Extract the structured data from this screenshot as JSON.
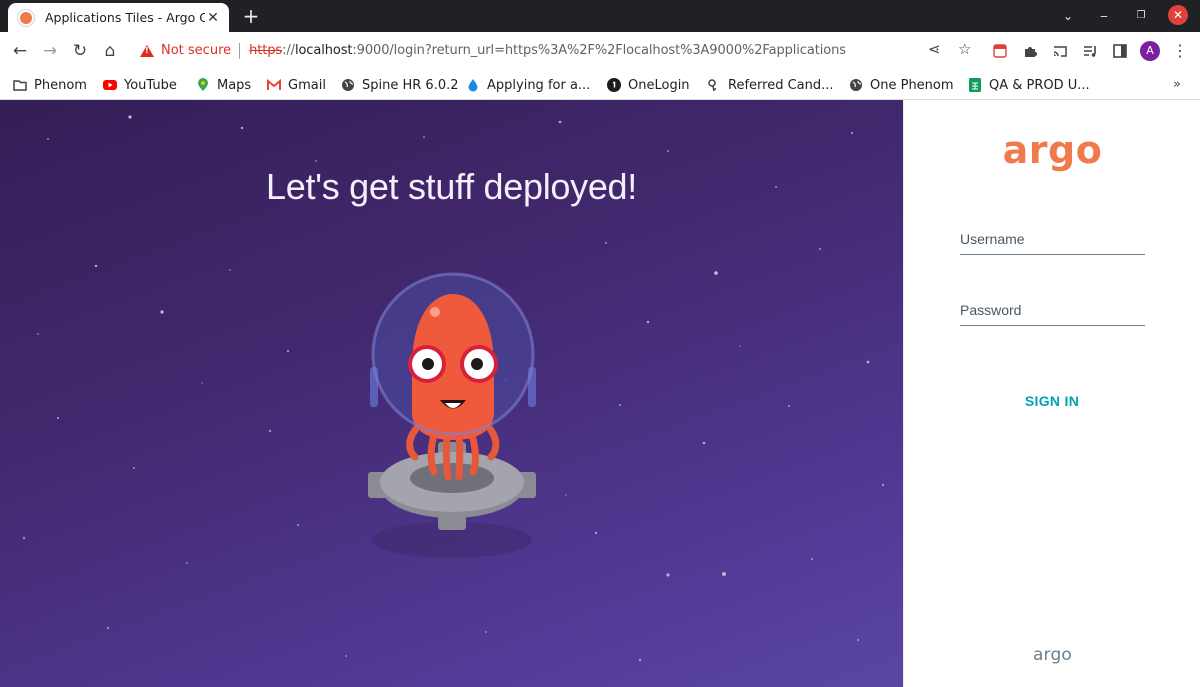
{
  "browser": {
    "tab_title": "Applications Tiles - Argo C",
    "new_tab_symbol": "+",
    "close_symbol": "✕",
    "security_label": "Not secure",
    "url": {
      "scheme": "https",
      "sep": "://",
      "host": "localhost",
      "rest": ":9000/login?return_url=https%3A%2F%2Flocalhost%3A9000%2Fapplications"
    },
    "avatar_letter": "A"
  },
  "bookmarks": [
    {
      "label": "Phenom",
      "icon": "folder-icon",
      "color": "#444444"
    },
    {
      "label": "YouTube",
      "icon": "youtube-icon",
      "color": "#ff0000"
    },
    {
      "label": "Maps",
      "icon": "maps-icon",
      "color": "#34a853"
    },
    {
      "label": "Gmail",
      "icon": "gmail-icon",
      "color": "#ea4335"
    },
    {
      "label": "Spine HR 6.0.2",
      "icon": "globe-icon",
      "color": "#444444"
    },
    {
      "label": "Applying for a...",
      "icon": "drop-icon",
      "color": "#1e88e5"
    },
    {
      "label": "OneLogin",
      "icon": "onelogin-icon",
      "color": "#1c1c1c"
    },
    {
      "label": "Referred Cand...",
      "icon": "key-icon",
      "color": "#444444"
    },
    {
      "label": "One Phenom",
      "icon": "globe-icon",
      "color": "#444444"
    },
    {
      "label": "QA & PROD U...",
      "icon": "sheets-icon",
      "color": "#0f9d58"
    }
  ],
  "bookmarks_more": "»",
  "hero": {
    "title": "Let's get stuff deployed!"
  },
  "login": {
    "logo": "argo",
    "username_label": "Username",
    "password_label": "Password",
    "signin_label": "SIGN IN",
    "footer_logo": "argo"
  },
  "colors": {
    "argo_orange": "#ef7b4d",
    "signin_teal": "#00a2b3",
    "hero_purple": "#42296f"
  }
}
